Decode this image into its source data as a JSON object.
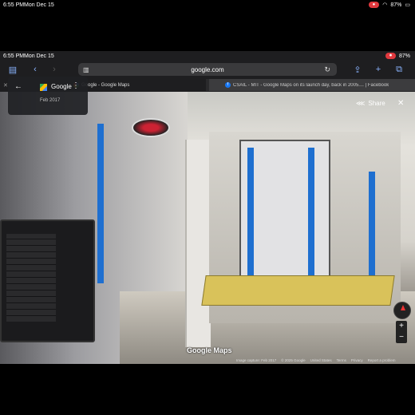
{
  "status": {
    "time": "6:55 PM",
    "date": "Mon Dec 15",
    "battery": "87%"
  },
  "browser": {
    "url": "google.com",
    "tabs": [
      {
        "label": "Google - Google Maps"
      },
      {
        "label": "CSAIL - MIT - Google Maps on its launch day, back in 2005.... | Facebook"
      }
    ]
  },
  "place_card": {
    "title": "Google",
    "date": "Feb 2017"
  },
  "map_controls": {
    "share_label": "Share"
  },
  "footer": {
    "logo": "Google Maps",
    "capture": "Image capture: Feb 2017",
    "copyright": "© 2025 Google",
    "country": "United States",
    "terms": "Terms",
    "privacy": "Privacy",
    "report": "Report a problem"
  },
  "icons": [
    "sidebar-icon",
    "back-icon",
    "forward-icon",
    "reader-icon",
    "reload-icon",
    "share-icon",
    "new-tab-icon",
    "tabs-icon",
    "more-icon",
    "close-icon",
    "compass-icon",
    "zoom-in-icon",
    "zoom-out-icon"
  ]
}
